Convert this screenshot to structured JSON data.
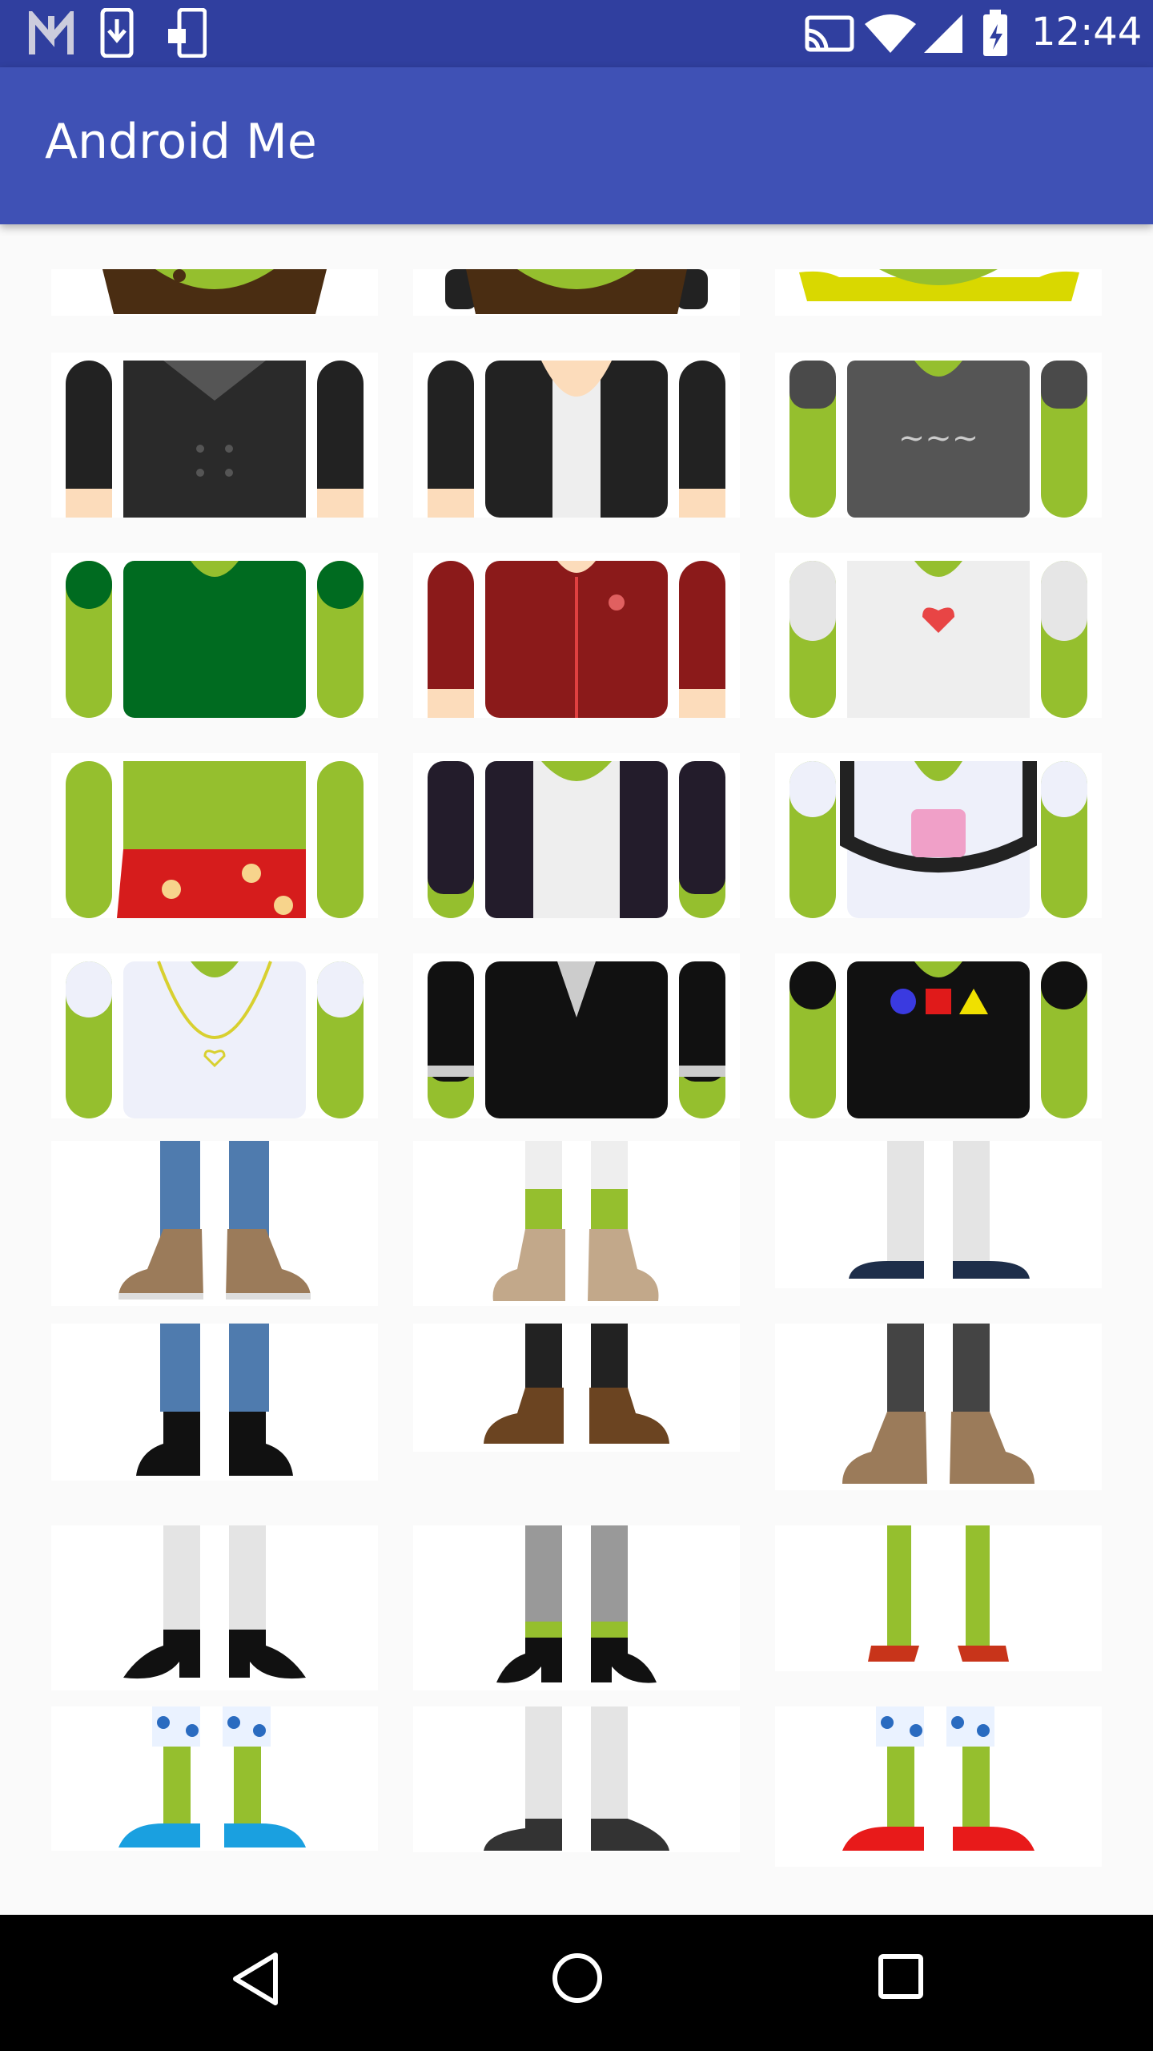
{
  "status": {
    "time": "12:44"
  },
  "app": {
    "title": "Android Me"
  },
  "navbar": {
    "buttons": [
      "back",
      "home",
      "recents"
    ]
  },
  "colors": {
    "primary": "#3f51b5",
    "primary_dark": "#303f9f",
    "android_green": "#95bf2e"
  }
}
